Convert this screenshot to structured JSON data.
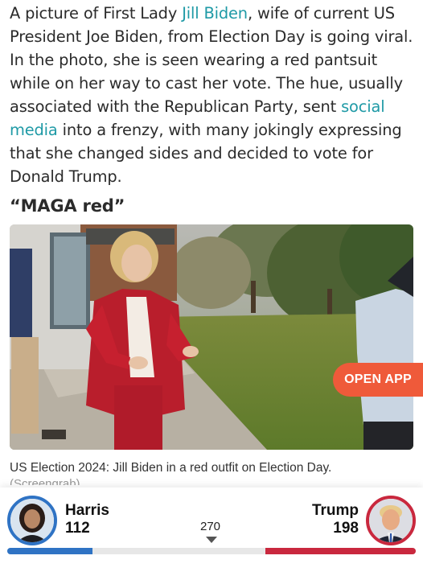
{
  "article": {
    "p1": "A picture of First Lady ",
    "link_jill": "Jill Biden",
    "p2": ", wife of current US President Joe Biden, from Election Day is going viral. In the photo, she is seen wearing a red pantsuit while on her way to cast her vote. The hue, usually associated with the Republican Party, sent ",
    "link_social": "social media",
    "p3": " into a frenzy, with many jokingly expressing that she changed sides and decided to vote for Donald Trump.",
    "heading": "“MAGA red”",
    "caption": "US Election 2024: Jill Biden in a red outfit on Election Day.",
    "caption_more": "(Screengrab)"
  },
  "open_app_label": "OPEN APP",
  "election_widget": {
    "harris": {
      "name": "Harris",
      "votes": "112",
      "color": "#2f73c4"
    },
    "trump": {
      "name": "Trump",
      "votes": "198",
      "color": "#c9283e"
    },
    "threshold": "270",
    "total": 538,
    "harris_share": 0.208,
    "trump_share": 0.368
  },
  "colors": {
    "link": "#1f9aa6",
    "open_app_bg": "#ef5a3a",
    "bar_track": "#e7e7e7"
  },
  "icons": {
    "threshold_marker": "triangle-down-icon"
  }
}
